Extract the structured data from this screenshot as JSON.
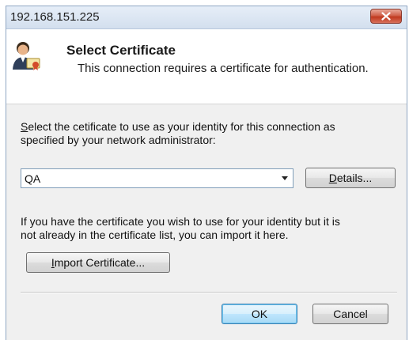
{
  "window": {
    "title": "192.168.151.225"
  },
  "header": {
    "title": "Select Certificate",
    "subtitle": "This connection requires a certificate for authentication."
  },
  "instructions": {
    "select_accesskey": "S",
    "select_rest": "elect the cetificate to use as your identity for this connection as",
    "select_line2": "specified by your network administrator:"
  },
  "certificate_select": {
    "value": "QA"
  },
  "details_button": {
    "accesskey": "D",
    "rest": "etails..."
  },
  "import_text": {
    "line1": "If you have the certificate you wish to use for your identity but it is",
    "line2": "not already in the certificate list, you can import it here."
  },
  "import_button": {
    "accesskey": "I",
    "rest": "mport Certificate..."
  },
  "buttons": {
    "ok": "OK",
    "cancel": "Cancel"
  },
  "icons": {
    "close": "close-icon",
    "certificate": "certificate-user-icon"
  }
}
